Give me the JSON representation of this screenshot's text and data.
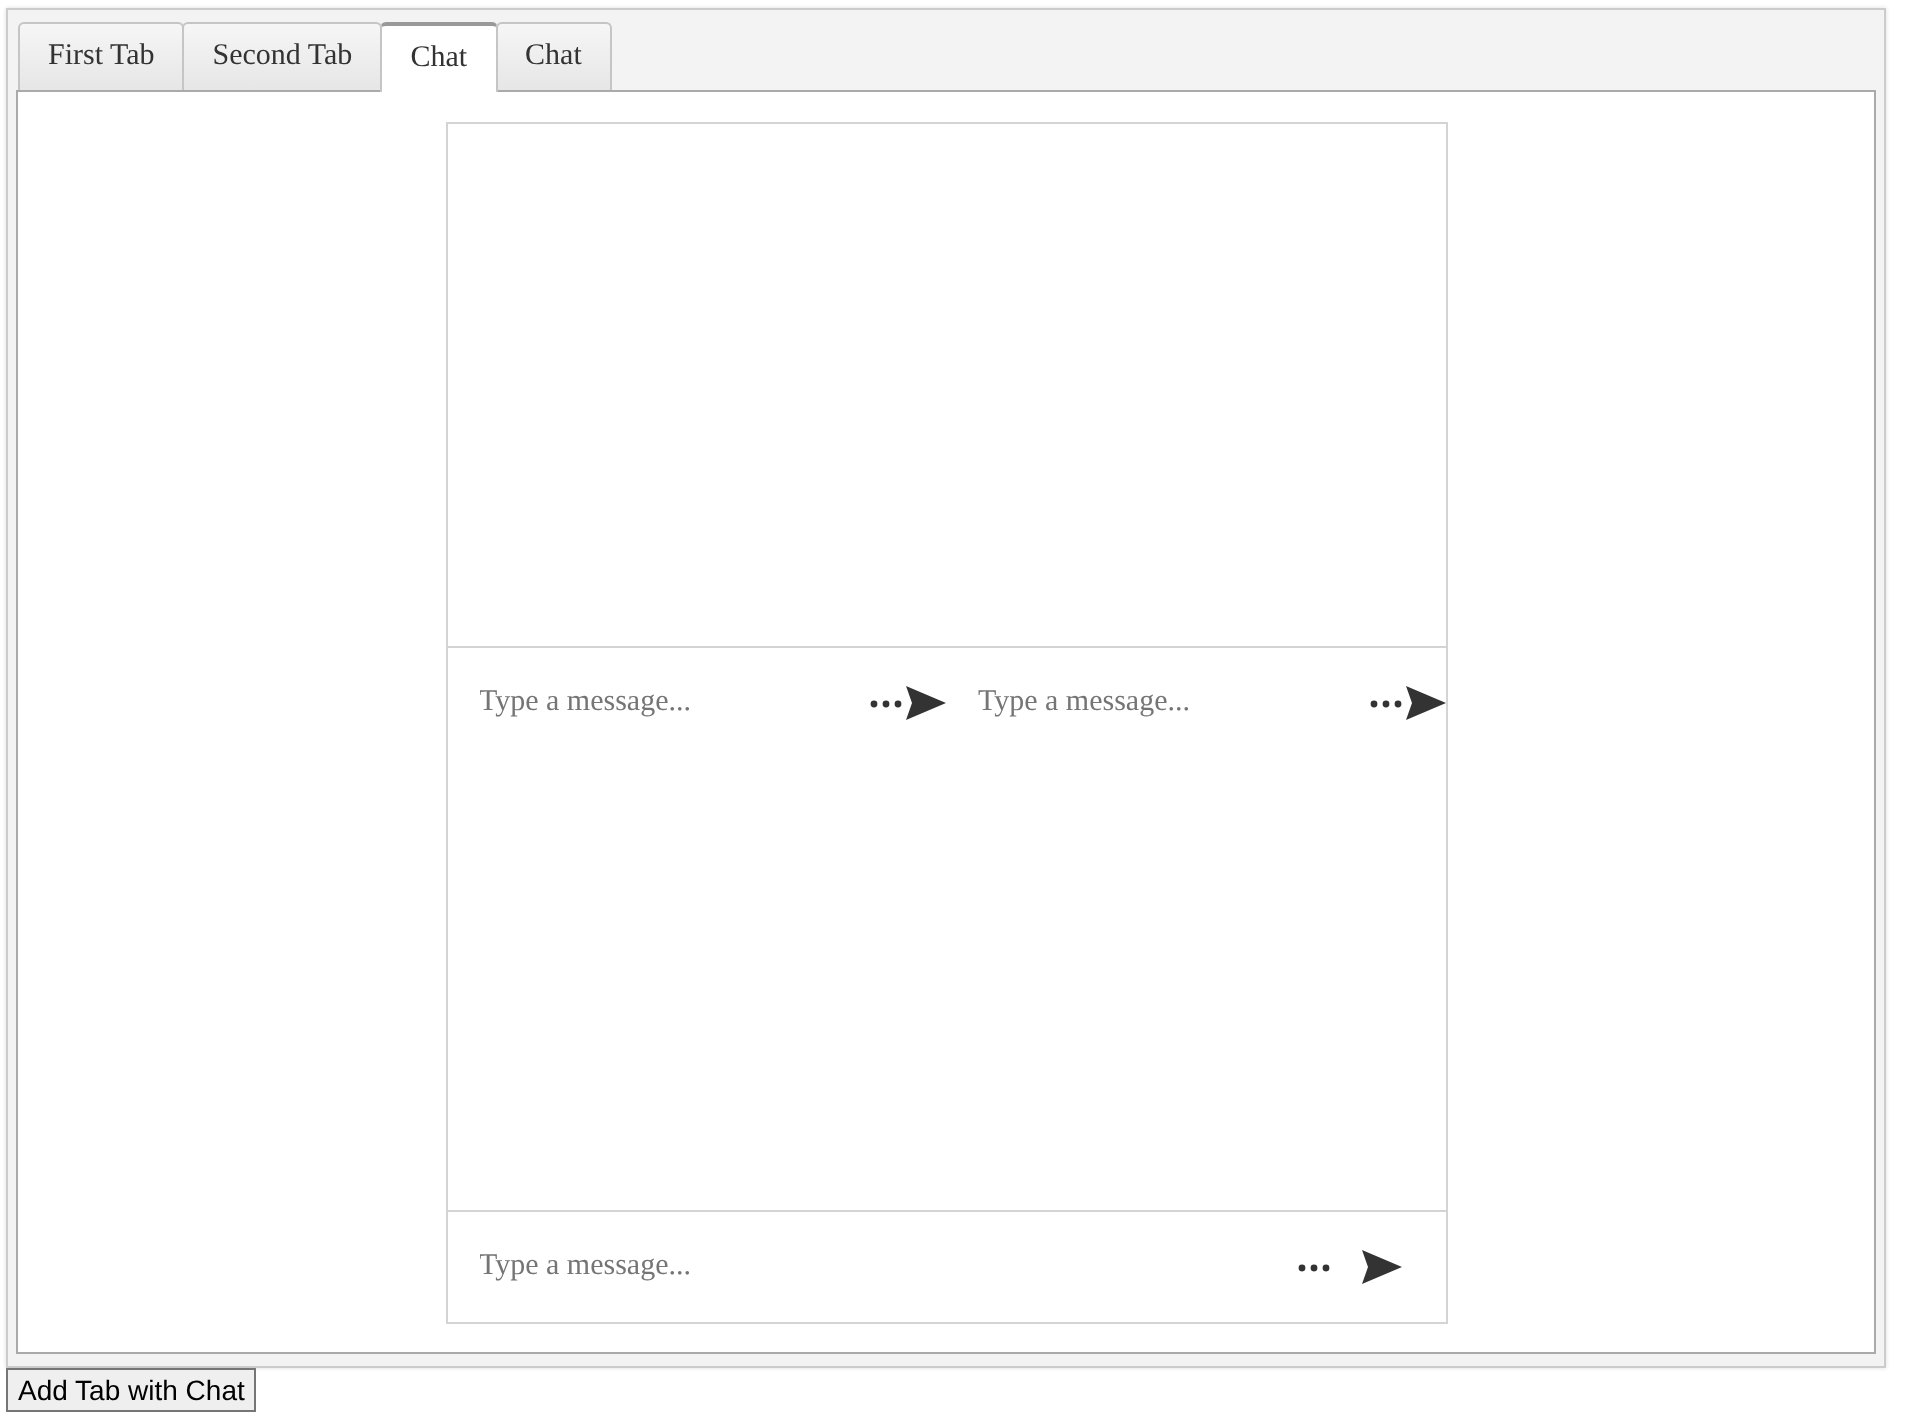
{
  "tabs": [
    {
      "label": "First Tab",
      "selected": false
    },
    {
      "label": "Second Tab",
      "selected": false
    },
    {
      "label": "Chat",
      "selected": true
    },
    {
      "label": "Chat",
      "selected": false
    }
  ],
  "chat": {
    "sections": [
      {
        "kind": "messages"
      },
      {
        "kind": "composer-row",
        "composers": [
          {
            "placeholder": "Type a message..."
          },
          {
            "placeholder": "Type a message..."
          }
        ]
      },
      {
        "kind": "messages"
      },
      {
        "kind": "composer-row",
        "composers": [
          {
            "placeholder": "Type a message..."
          }
        ]
      }
    ]
  },
  "add_button": "Add Tab with Chat"
}
